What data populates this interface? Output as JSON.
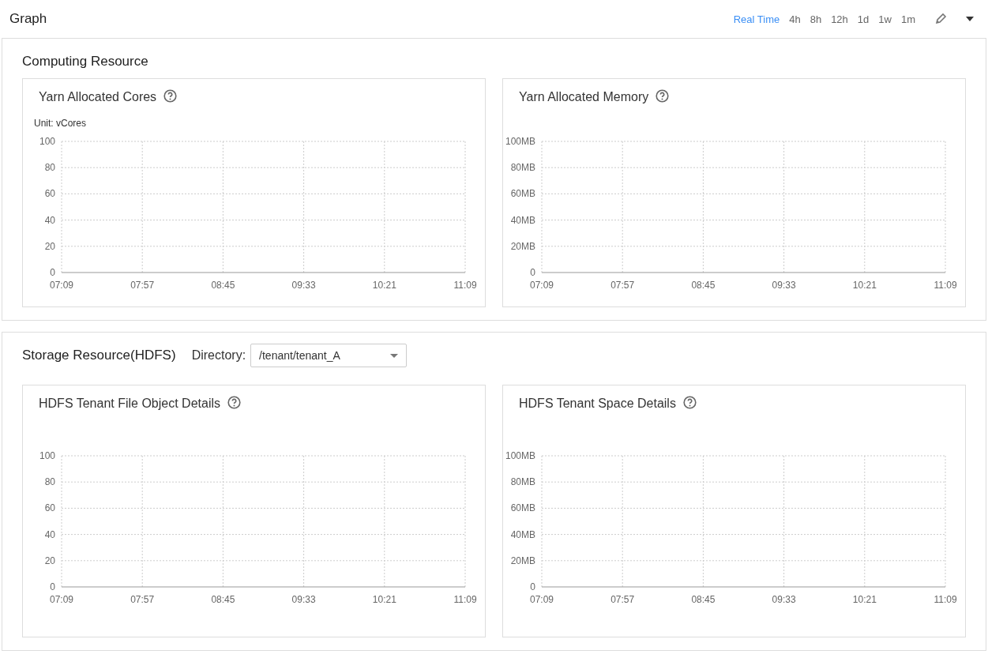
{
  "header": {
    "title": "Graph",
    "ranges": [
      {
        "label": "Real Time",
        "selected": true
      },
      {
        "label": "4h",
        "selected": false
      },
      {
        "label": "8h",
        "selected": false
      },
      {
        "label": "12h",
        "selected": false
      },
      {
        "label": "1d",
        "selected": false
      },
      {
        "label": "1w",
        "selected": false
      },
      {
        "label": "1m",
        "selected": false
      }
    ]
  },
  "sections": [
    {
      "title": "Computing Resource",
      "cards": [
        {
          "title": "Yarn Allocated Cores",
          "unit": "Unit: vCores",
          "chart_data": {
            "type": "line",
            "grid": true,
            "categories": [
              "07:09",
              "07:57",
              "08:45",
              "09:33",
              "10:21",
              "11:09"
            ],
            "ylim": [
              0,
              100
            ],
            "yticks": [
              0,
              20,
              40,
              60,
              80,
              100
            ]
          }
        },
        {
          "title": "Yarn Allocated Memory",
          "chart_data": {
            "type": "line",
            "grid": true,
            "categories": [
              "07:09",
              "07:57",
              "08:45",
              "09:33",
              "10:21",
              "11:09"
            ],
            "ylim": [
              0,
              100
            ],
            "yticks": [
              {
                "value": 0,
                "label": "0"
              },
              {
                "value": 20,
                "label": "20MB"
              },
              {
                "value": 40,
                "label": "40MB"
              },
              {
                "value": 60,
                "label": "60MB"
              },
              {
                "value": 80,
                "label": "80MB"
              },
              {
                "value": 100,
                "label": "100MB"
              }
            ]
          }
        }
      ]
    },
    {
      "title": "Storage Resource(HDFS)",
      "directory": {
        "label": "Directory:",
        "value": "/tenant/tenant_A"
      },
      "cards": [
        {
          "title": "HDFS Tenant File Object Details",
          "chart_data": {
            "type": "line",
            "grid": true,
            "categories": [
              "07:09",
              "07:57",
              "08:45",
              "09:33",
              "10:21",
              "11:09"
            ],
            "ylim": [
              0,
              100
            ],
            "yticks": [
              0,
              20,
              40,
              60,
              80,
              100
            ]
          }
        },
        {
          "title": "HDFS Tenant Space Details",
          "chart_data": {
            "type": "line",
            "grid": true,
            "categories": [
              "07:09",
              "07:57",
              "08:45",
              "09:33",
              "10:21",
              "11:09"
            ],
            "ylim": [
              0,
              100
            ],
            "yticks": [
              {
                "value": 0,
                "label": "0"
              },
              {
                "value": 20,
                "label": "20MB"
              },
              {
                "value": 40,
                "label": "40MB"
              },
              {
                "value": 60,
                "label": "60MB"
              },
              {
                "value": 80,
                "label": "80MB"
              },
              {
                "value": 100,
                "label": "100MB"
              }
            ]
          }
        }
      ]
    }
  ]
}
